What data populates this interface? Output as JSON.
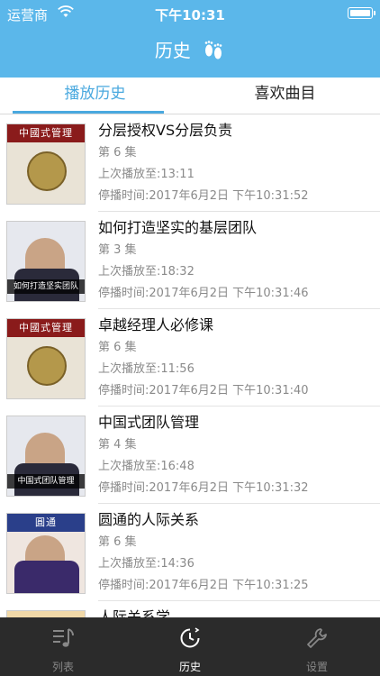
{
  "status_bar": {
    "carrier": "运营商",
    "time": "下午10:31"
  },
  "header": {
    "title": "历史"
  },
  "tabs": {
    "items": [
      {
        "label": "播放历史",
        "active": true
      },
      {
        "label": "喜欢曲目",
        "active": false
      }
    ]
  },
  "history": [
    {
      "title": "分层授权VS分层负责",
      "episode": "第 6 集",
      "last_played": "上次播放至:13:11",
      "stopped_at": "停播时间:2017年6月2日 下午10:31:52",
      "cover_band": "中國式管理",
      "cover_style": "disc"
    },
    {
      "title": "如何打造坚实的基层团队",
      "episode": "第 3 集",
      "last_played": "上次播放至:18:32",
      "stopped_at": "停播时间:2017年6月2日 下午10:31:46",
      "cover_band": "",
      "cover_tag": "如何打造坚实团队",
      "cover_style": "person"
    },
    {
      "title": "卓越经理人必修课",
      "episode": "第 6 集",
      "last_played": "上次播放至:11:56",
      "stopped_at": "停播时间:2017年6月2日 下午10:31:40",
      "cover_band": "中國式管理",
      "cover_style": "disc"
    },
    {
      "title": "中国式团队管理",
      "episode": "第 4 集",
      "last_played": "上次播放至:16:48",
      "stopped_at": "停播时间:2017年6月2日 下午10:31:32",
      "cover_band": "",
      "cover_tag": "中国式团队管理",
      "cover_style": "person"
    },
    {
      "title": "圆通的人际关系",
      "episode": "第 6 集",
      "last_played": "上次播放至:14:36",
      "stopped_at": "停播时间:2017年6月2日 下午10:31:25",
      "cover_band": "圓通",
      "cover_style": "person"
    },
    {
      "title": "人际关系学",
      "episode": "",
      "last_played": "",
      "stopped_at": "",
      "cover_band": "",
      "cover_style": "disc"
    }
  ],
  "tabbar": {
    "items": [
      {
        "label": "列表",
        "icon": "music-list-icon",
        "active": false
      },
      {
        "label": "历史",
        "icon": "clock-icon",
        "active": true
      },
      {
        "label": "设置",
        "icon": "wrench-icon",
        "active": false
      }
    ]
  },
  "colors": {
    "header": "#5bb7ea",
    "accent": "#4aa9df",
    "tabbar": "#2b2b2b"
  }
}
